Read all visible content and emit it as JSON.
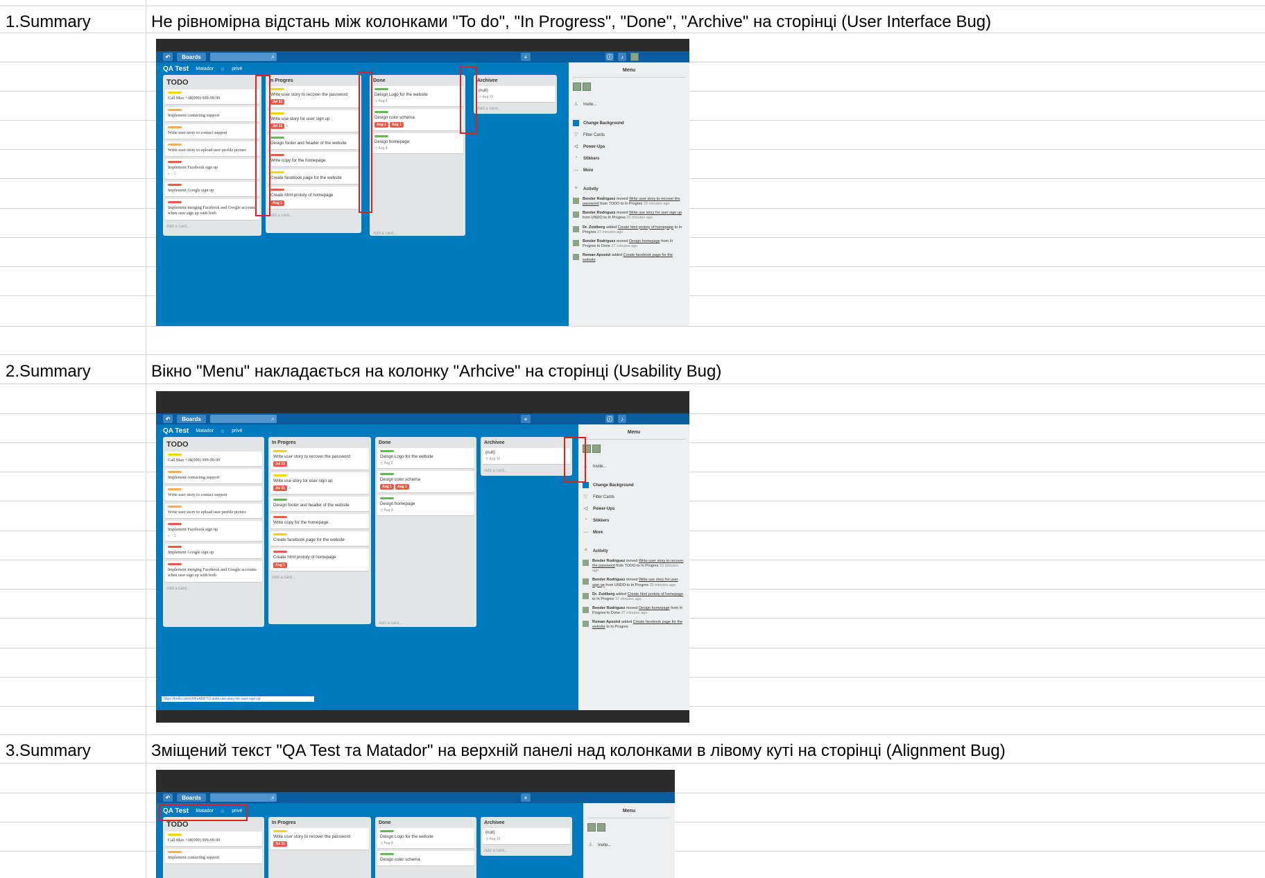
{
  "rows": [
    {
      "id": "1",
      "label": "1.Summary",
      "text": "Не рівномірна відстань між колонками \"To do\", \"In Progress\", \"Done\", \"Archive\" на сторінці   (User Interface Bug)"
    },
    {
      "id": "2",
      "label": "2.Summary",
      "text": "Вікно \"Menu\" накладається на колонку \"Arhcive\" на сторінці (Usability Bug)"
    },
    {
      "id": "3",
      "label": "3.Summary",
      "text": "Зміщений текст \"QA Test та Matador\"  на верхній панелі над колонками в лівому куті на сторінці (Alignment Bug)"
    }
  ],
  "trello": {
    "boards_label": "Boards",
    "board_title": "QA Test",
    "team": "Matador",
    "visibility": "privé",
    "add_card": "Add a card...",
    "columns": [
      {
        "title": "TODO",
        "cards": [
          {
            "label_color": "#f2d600",
            "text": "Call Max +38(099) 999-99-99"
          },
          {
            "label_color": "#ffab4a",
            "text": "Implement contacting support"
          },
          {
            "label_color": "#ffab4a",
            "text": "Write user story to contact support"
          },
          {
            "label_color": "#ffab4a",
            "text": "Write user story to upload user profile picture"
          },
          {
            "label_color": "#eb5a46",
            "text": "Implement Facebook sign up",
            "meta": "≡  ◌ 1"
          },
          {
            "label_color": "#eb5a46",
            "text": "Implement Google sign up"
          },
          {
            "label_color": "#eb5a46",
            "text": "Implement merging Facebook and Google accounts when user sign up with both"
          }
        ]
      },
      {
        "title": "In Progres",
        "cards": [
          {
            "label_color": "#f2d600",
            "text": "Write user story to recover the password",
            "due": [
              "Jul 31"
            ]
          },
          {
            "label_color": "#f2d600",
            "text": "Write use story for user sign up",
            "due": [
              "Jul 31"
            ],
            "meta": "≡"
          },
          {
            "label_color": "#61bd4f",
            "text": "Design footer and header of the website"
          },
          {
            "label_color": "#eb5a46",
            "text": "Write copy for the homepage."
          },
          {
            "label_color": "#f2d600",
            "text": "Create facebook page for the website"
          },
          {
            "label_color": "#eb5a46",
            "text": "Create html prototy of homepage",
            "due": [
              "Aug 1"
            ]
          }
        ]
      },
      {
        "title": "Done",
        "cards": [
          {
            "label_color": "#61bd4f",
            "text": "Deisgn Logo for the website",
            "meta": "◷ Aug 9"
          },
          {
            "label_color": "#61bd4f",
            "text": "Design color schema",
            "due": [
              "Aug 1",
              "Aug 1"
            ]
          },
          {
            "label_color": "#61bd4f",
            "text": "Design homepage",
            "meta": "◷ Aug 9"
          }
        ]
      },
      {
        "title": "Archivee",
        "cards": [
          {
            "label_color": "",
            "text": "(null)",
            "meta": "◷ Aug 10"
          }
        ]
      }
    ],
    "menu": {
      "title": "Menu",
      "invite": "Invite...",
      "items": [
        "Change Background",
        "Filter Cards",
        "Power-Ups",
        "Stikkers",
        "More"
      ],
      "activity_title": "Activity",
      "activity": [
        {
          "who": "Bender Rodriguez",
          "verb": "moved",
          "what": "Write user story to recover the password",
          "rest": "from TODO to In Progres",
          "time": "33 minutes ago"
        },
        {
          "who": "Bender Rodriguez",
          "verb": "moved",
          "what": "Write use story for user sign up",
          "rest": "from UNDO to In Progres",
          "time": "35 minutes ago"
        },
        {
          "who": "Dr. Zoidberg",
          "verb": "added",
          "what": "Create html prototy of homepage",
          "rest": "to In Progres",
          "time": "37 minutes ago"
        },
        {
          "who": "Bender Rodriguez",
          "verb": "moved",
          "what": "Design homepage",
          "rest": "from In Progres to Done",
          "time": "27 minutes ago"
        },
        {
          "who": "Roman Apostol",
          "verb": "added",
          "what": "Create facebook page for the website",
          "rest": "to In Progres",
          "time": ""
        }
      ]
    },
    "status_url": "https://trello.com/c/0FuhBiFT/2-write-use-story-for-user-sign-up"
  }
}
